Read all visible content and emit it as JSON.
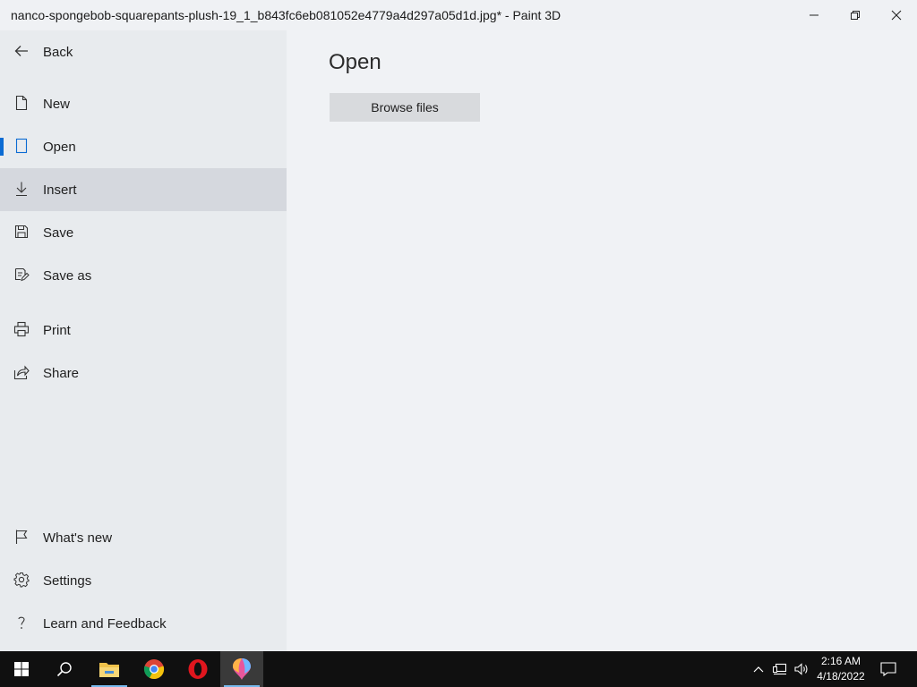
{
  "window": {
    "title": "nanco-spongebob-squarepants-plush-19_1_b843fc6eb081052e4779a4d297a05d1d.jpg* - Paint 3D"
  },
  "sidebar": {
    "back_label": "Back",
    "items": [
      {
        "label": "New",
        "icon": "new-file-icon"
      },
      {
        "label": "Open",
        "icon": "open-file-icon",
        "selected": true
      },
      {
        "label": "Insert",
        "icon": "insert-icon",
        "hovered": true
      },
      {
        "label": "Save",
        "icon": "save-icon"
      },
      {
        "label": "Save as",
        "icon": "save-as-icon"
      },
      {
        "label": "Print",
        "icon": "print-icon"
      },
      {
        "label": "Share",
        "icon": "share-icon"
      }
    ],
    "footer_items": [
      {
        "label": "What's new",
        "icon": "flag-icon"
      },
      {
        "label": "Settings",
        "icon": "gear-icon"
      },
      {
        "label": "Learn and Feedback",
        "icon": "question-icon"
      }
    ]
  },
  "main": {
    "title": "Open",
    "browse_label": "Browse files"
  },
  "taskbar": {
    "apps": [
      "start-icon",
      "search-icon",
      "file-explorer-icon",
      "chrome-icon",
      "opera-icon",
      "paint-3d-icon"
    ],
    "active_app": "paint-3d-icon",
    "clock": {
      "time": "2:16 AM",
      "date": "4/18/2022"
    }
  },
  "colors": {
    "accent": "#0b6bd3",
    "sidebar_bg": "#e8ebee",
    "main_bg": "#f0f2f5",
    "taskbar_bg": "#101010"
  }
}
